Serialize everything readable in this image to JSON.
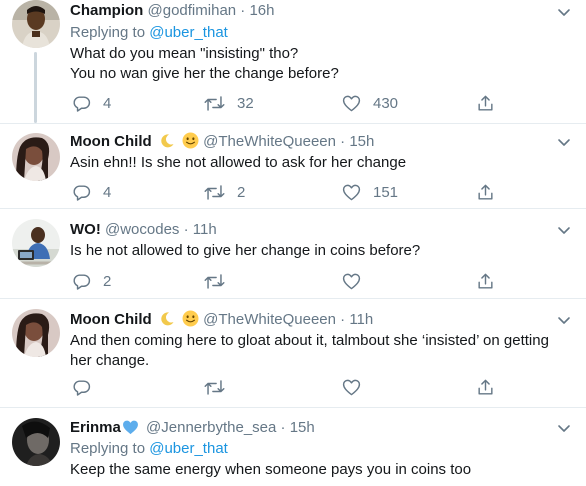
{
  "tweets": [
    {
      "name": "Champion",
      "handle": "@godfimihan",
      "sep": "·",
      "time": "16h",
      "reply_prefix": "Replying to ",
      "reply_handle": "@uber_that",
      "text_lines": [
        "What do you mean \"insisting\" tho?",
        "You no wan give her the change before?"
      ],
      "replies": "4",
      "retweets": "32",
      "likes": "430"
    },
    {
      "name": "Moon Child",
      "emojis": [
        "crescent-moon-icon",
        "smiling-face-icon"
      ],
      "handle": "@TheWhiteQueeen",
      "sep": "·",
      "time": "15h",
      "text_lines": [
        "Asin ehn!! Is she not allowed to ask for her change"
      ],
      "replies": "4",
      "retweets": "2",
      "likes": "151"
    },
    {
      "name": "WO!",
      "handle": "@wocodes",
      "sep": "·",
      "time": "11h",
      "text_lines": [
        "Is he not allowed to give her change in coins before?"
      ],
      "replies": "2",
      "retweets": "",
      "likes": ""
    },
    {
      "name": "Moon Child",
      "emojis": [
        "crescent-moon-icon",
        "smiling-face-icon"
      ],
      "handle": "@TheWhiteQueeen",
      "sep": "·",
      "time": "11h",
      "text_lines": [
        "And then coming here to gloat about it, talmbout she ‘insisted’ on getting",
        "her change."
      ],
      "replies": "",
      "retweets": "",
      "likes": ""
    },
    {
      "name": "Erinma",
      "emojis": [
        "blue-heart-icon"
      ],
      "handle": "@Jennerbythe_sea",
      "sep": "·",
      "time": "15h",
      "reply_prefix": "Replying to ",
      "reply_handle": "@uber_that",
      "text_lines": [
        "Keep the same energy when someone pays you in coins too"
      ]
    }
  ],
  "colors": {
    "text": "#14171a",
    "muted": "#657786",
    "link": "#1b95e0",
    "divider": "#e6ecf0",
    "thread_line": "#ccd6dd"
  }
}
